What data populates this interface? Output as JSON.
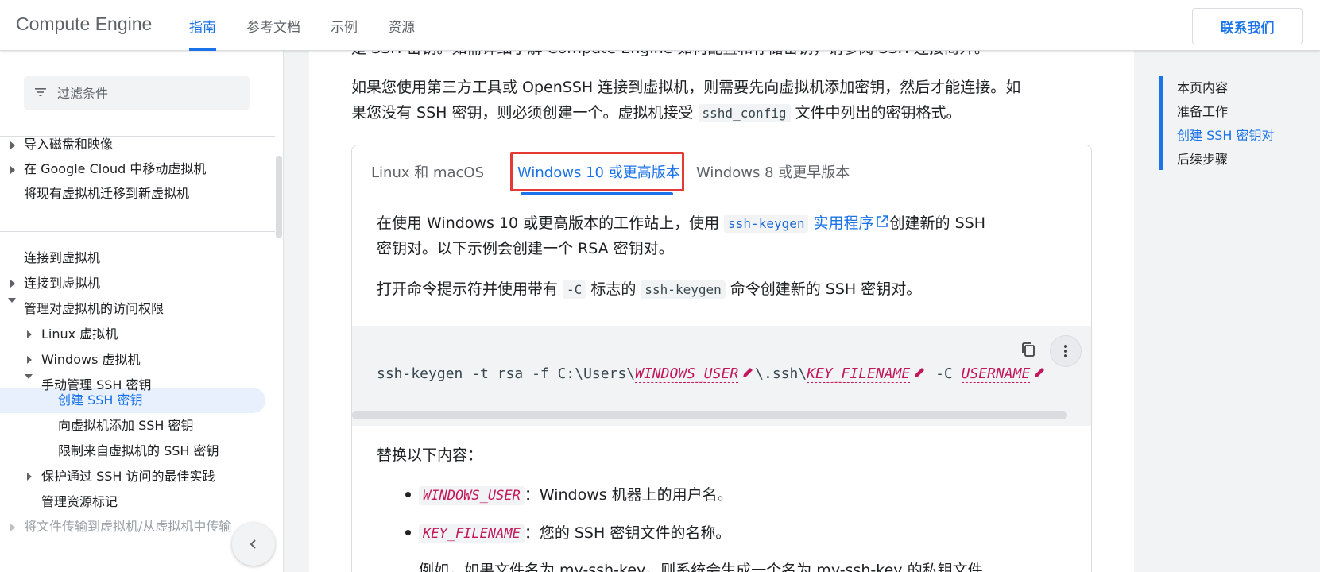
{
  "header": {
    "brand": "Compute Engine",
    "nav": [
      "指南",
      "参考文档",
      "示例",
      "资源"
    ],
    "contact_label": "联系我们"
  },
  "sidebar": {
    "filter_placeholder": "过滤条件",
    "items": [
      "导入磁盘和映像",
      "在 Google Cloud 中移动虚拟机",
      "将现有虚拟机迁移到新虚拟机",
      "连接到虚拟机",
      "连接到虚拟机",
      "管理对虚拟机的访问权限",
      "Linux 虚拟机",
      "Windows 虚拟机",
      "手动管理 SSH 密钥",
      "创建 SSH 密钥",
      "向虚拟机添加 SSH 密钥",
      "限制来自虚拟机的 SSH 密钥",
      "保护通过 SSH 访问的最佳实践",
      "管理资源标记",
      "将文件传输到虚拟机/从虚拟机中传输"
    ]
  },
  "main": {
    "top_partial": "是 SSH 密钥。如需详细了解 Compute Engine 如何配置和存储密钥，请参阅 SSH 连接简介。",
    "intro_1": "如果您使用第三方工具或 OpenSSH 连接到虚拟机，则需要先向虚拟机添加密钥，然后才能连接。如",
    "intro_2a": "果您没有 SSH 密钥，则必须创建一个。虚拟机接受 ",
    "intro_code": "sshd_config",
    "intro_2b": " 文件中列出的密钥格式。",
    "tabs": [
      "Linux 和 macOS",
      "Windows 10 或更高版本",
      "Windows 8 或更早版本"
    ],
    "para1_a": "在使用 Windows 10 或更高版本的工作站上，使用 ",
    "para1_code": "ssh-keygen",
    "para1_link": "实用程序",
    "para1_b": "创建新的 SSH",
    "para1_line2": "密钥对。以下示例会创建一个 RSA 密钥对。",
    "para2_a": "打开命令提示符并使用带有 ",
    "para2_code1": "-C",
    "para2_b": " 标志的 ",
    "para2_code2": "ssh-keygen",
    "para2_c": " 命令创建新的 SSH 密钥对。",
    "code": {
      "p1": "ssh-keygen -t rsa -f C:\\Users\\",
      "v1": "WINDOWS_USER",
      "p2": "\\.ssh\\",
      "v2": "KEY_FILENAME",
      "p3": " -C ",
      "v3": "USERNAME"
    },
    "replace_label": "替换以下内容：",
    "bullets": [
      {
        "var": "WINDOWS_USER",
        "text": "：Windows 机器上的用户名。"
      },
      {
        "var": "KEY_FILENAME",
        "text": "：您的 SSH 密钥文件的名称。"
      }
    ],
    "bottom_partial": "例如，如果文件名为 my-ssh-key，则系统会生成一个名为 my-ssh-key 的私钥文件"
  },
  "toc": {
    "items": [
      "本页内容",
      "准备工作",
      "创建 SSH 密钥对",
      "后续步骤"
    ]
  }
}
